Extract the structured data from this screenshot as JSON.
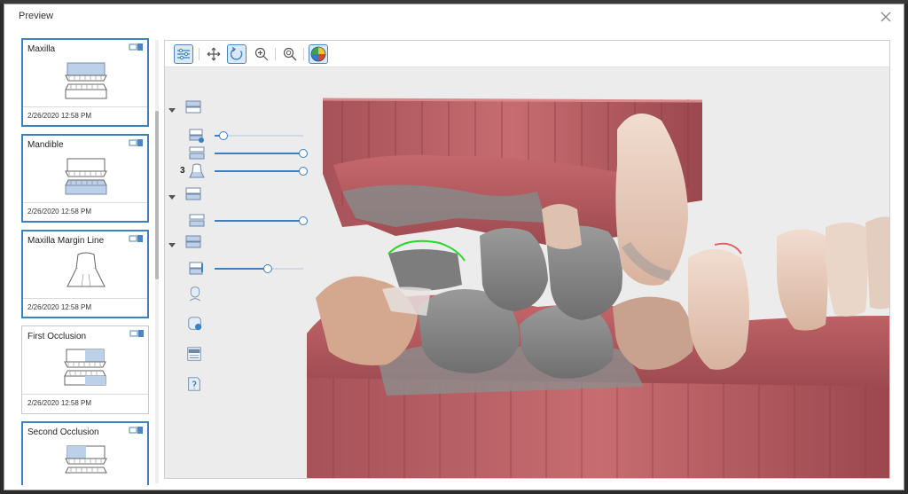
{
  "window": {
    "title": "Preview"
  },
  "sidebar": {
    "cards": [
      {
        "label": "Maxilla",
        "date": "2/26/2020 12:58 PM",
        "selected": true,
        "icon": "maxilla-icon"
      },
      {
        "label": "Mandible",
        "date": "2/26/2020 12:58 PM",
        "selected": true,
        "icon": "mandible-icon"
      },
      {
        "label": "Maxilla Margin Line",
        "date": "2/26/2020 12:58 PM",
        "selected": true,
        "icon": "margin-line-icon"
      },
      {
        "label": "First Occlusion",
        "date": "2/26/2020 12:58 PM",
        "selected": false,
        "icon": "first-occlusion-icon"
      },
      {
        "label": "Second Occlusion",
        "date": "",
        "selected": true,
        "icon": "second-occlusion-icon"
      }
    ]
  },
  "toolbar": {
    "buttons": [
      {
        "name": "layers-settings-icon",
        "active": true
      },
      {
        "name": "pan-icon",
        "active": false
      },
      {
        "name": "rotate-icon",
        "active": true
      },
      {
        "name": "zoom-in-icon",
        "active": false
      },
      {
        "name": "zoom-fit-icon",
        "active": false
      },
      {
        "name": "color-map-icon",
        "active": false
      }
    ]
  },
  "layers": {
    "sliders": [
      0.1,
      1.0,
      1.0,
      1.0,
      0.6
    ],
    "number_label": "3"
  },
  "colors": {
    "accent": "#3b7fc4",
    "gum": "#b85a5f",
    "tooth": "#8a8a8a"
  }
}
